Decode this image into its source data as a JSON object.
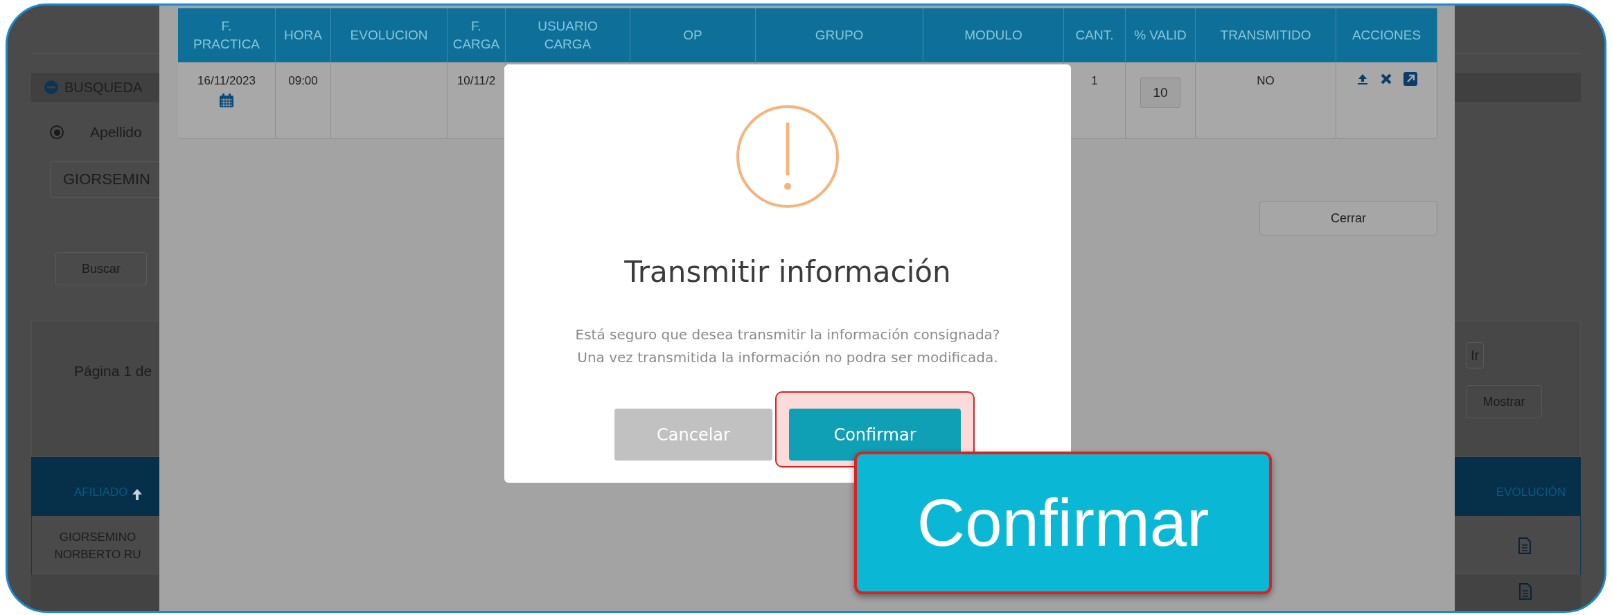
{
  "page": {
    "search_panel": {
      "title": "BUSQUEDA",
      "expanded": true
    },
    "search_options": [
      {
        "label": "Apellido",
        "selected": true
      }
    ],
    "search_field": {
      "value": "GIORSEMIN"
    },
    "search_button": "Buscar",
    "pagination": {
      "label": "Página 1 de",
      "go_button": "Ir",
      "show_button": "Mostrar"
    },
    "results_table": {
      "columns": [
        "AFILIADO",
        "EVOLUCIÓN"
      ],
      "rows": [
        {
          "afiliado": "GIORSEMINO\nNORBERTO RU"
        }
      ]
    }
  },
  "modal": {
    "table": {
      "columns": [
        "F.\nPRACTICA",
        "HORA",
        "EVOLUCION",
        "F.\nCARGA",
        "USUARIO\nCARGA",
        "OP",
        "GRUPO",
        "MODULO",
        "CANT.",
        "% VALID",
        "TRANSMITIDO",
        "ACCIONES"
      ],
      "rows": [
        {
          "cells": [
            {
              "kind": "date",
              "text": "16/11/2023"
            },
            {
              "kind": "text",
              "text": "09:00"
            },
            {
              "kind": "empty"
            },
            {
              "kind": "text",
              "text": "10/11/2"
            },
            {
              "kind": "empty"
            },
            {
              "kind": "empty"
            },
            {
              "kind": "empty"
            },
            {
              "kind": "empty"
            },
            {
              "kind": "text",
              "text": "1"
            },
            {
              "kind": "input",
              "text": "10"
            },
            {
              "kind": "text",
              "text": "NO"
            },
            {
              "kind": "actions"
            }
          ]
        }
      ]
    },
    "close_button": "Cerrar"
  },
  "dialog": {
    "title": "Transmitir información",
    "message": "Está seguro que desea transmitir la información consignada?\nUna vez transmitida la información no podra ser modificada.",
    "buttons": [
      {
        "kind": "cancel",
        "label": "Cancelar",
        "highlighted": false
      },
      {
        "kind": "confirm",
        "label": "Confirmar",
        "highlighted": true
      }
    ]
  },
  "callout": {
    "label": "Confirmar"
  }
}
